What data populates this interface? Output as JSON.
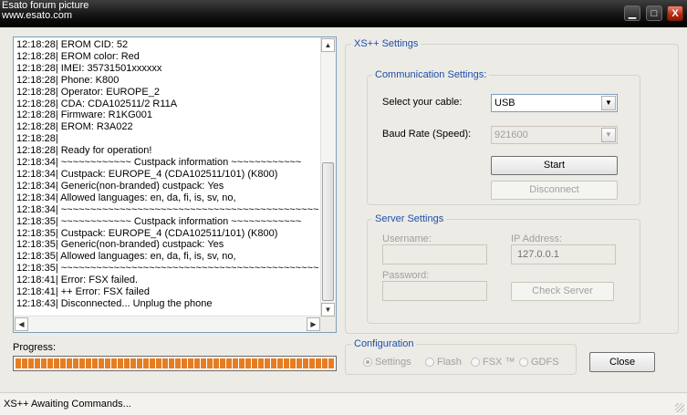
{
  "window": {
    "title_line1": "Esato forum picture",
    "title_line2": "www.esato.com",
    "minimize_glyph": "▁",
    "maximize_glyph": "□",
    "close_glyph": "X"
  },
  "log": {
    "lines": [
      "12:18:28| EROM CID: 52",
      "12:18:28| EROM color: Red",
      "12:18:28| IMEI: 35731501xxxxxx",
      "12:18:28| Phone: K800",
      "12:18:28| Operator: EUROPE_2",
      "12:18:28| CDA: CDA102511/2  R11A",
      "12:18:28| Firmware: R1KG001",
      "12:18:28| EROM: R3A022",
      "12:18:28|",
      "12:18:28| Ready for operation!",
      "12:18:34| ~~~~~~~~~~~~ Custpack information ~~~~~~~~~~~~",
      "12:18:34| Custpack: EUROPE_4 (CDA102511/101) (K800)",
      "12:18:34| Generic(non-branded) custpack: Yes",
      "12:18:34| Allowed languages: en, da, fi, is, sv, no,",
      "12:18:34| ~~~~~~~~~~~~~~~~~~~~~~~~~~~~~~~~~~~~~~~~~~~~",
      "12:18:35| ~~~~~~~~~~~~ Custpack information ~~~~~~~~~~~~",
      "12:18:35| Custpack: EUROPE_4 (CDA102511/101) (K800)",
      "12:18:35| Generic(non-branded) custpack: Yes",
      "12:18:35| Allowed languages: en, da, fi, is, sv, no,",
      "12:18:35| ~~~~~~~~~~~~~~~~~~~~~~~~~~~~~~~~~~~~~~~~~~~~",
      "12:18:41| Error: FSX failed.",
      "12:18:41| ++ Error: FSX failed",
      "12:18:43| Disconnected... Unplug the phone"
    ]
  },
  "xs_settings": {
    "title": "XS++ Settings",
    "communication": {
      "title": "Communication Settings:",
      "cable_label": "Select your cable:",
      "cable_value": "USB",
      "baud_label": "Baud Rate (Speed):",
      "baud_value": "921600",
      "start_label": "Start",
      "disconnect_label": "Disconnect"
    },
    "server": {
      "title": "Server Settings",
      "username_label": "Username:",
      "ip_label": "IP Address:",
      "ip_value": "127.0.0.1",
      "password_label": "Password:",
      "check_server_label": "Check Server"
    }
  },
  "progress": {
    "label": "Progress:",
    "fraction": 1.0,
    "color": "#e67d22"
  },
  "configuration": {
    "title": "Configuration",
    "options": [
      "Settings",
      "Flash",
      "FSX ™",
      "GDFS"
    ],
    "selected": "Settings"
  },
  "close_label": "Close",
  "status": {
    "text": "XS++ Awaiting Commands..."
  }
}
